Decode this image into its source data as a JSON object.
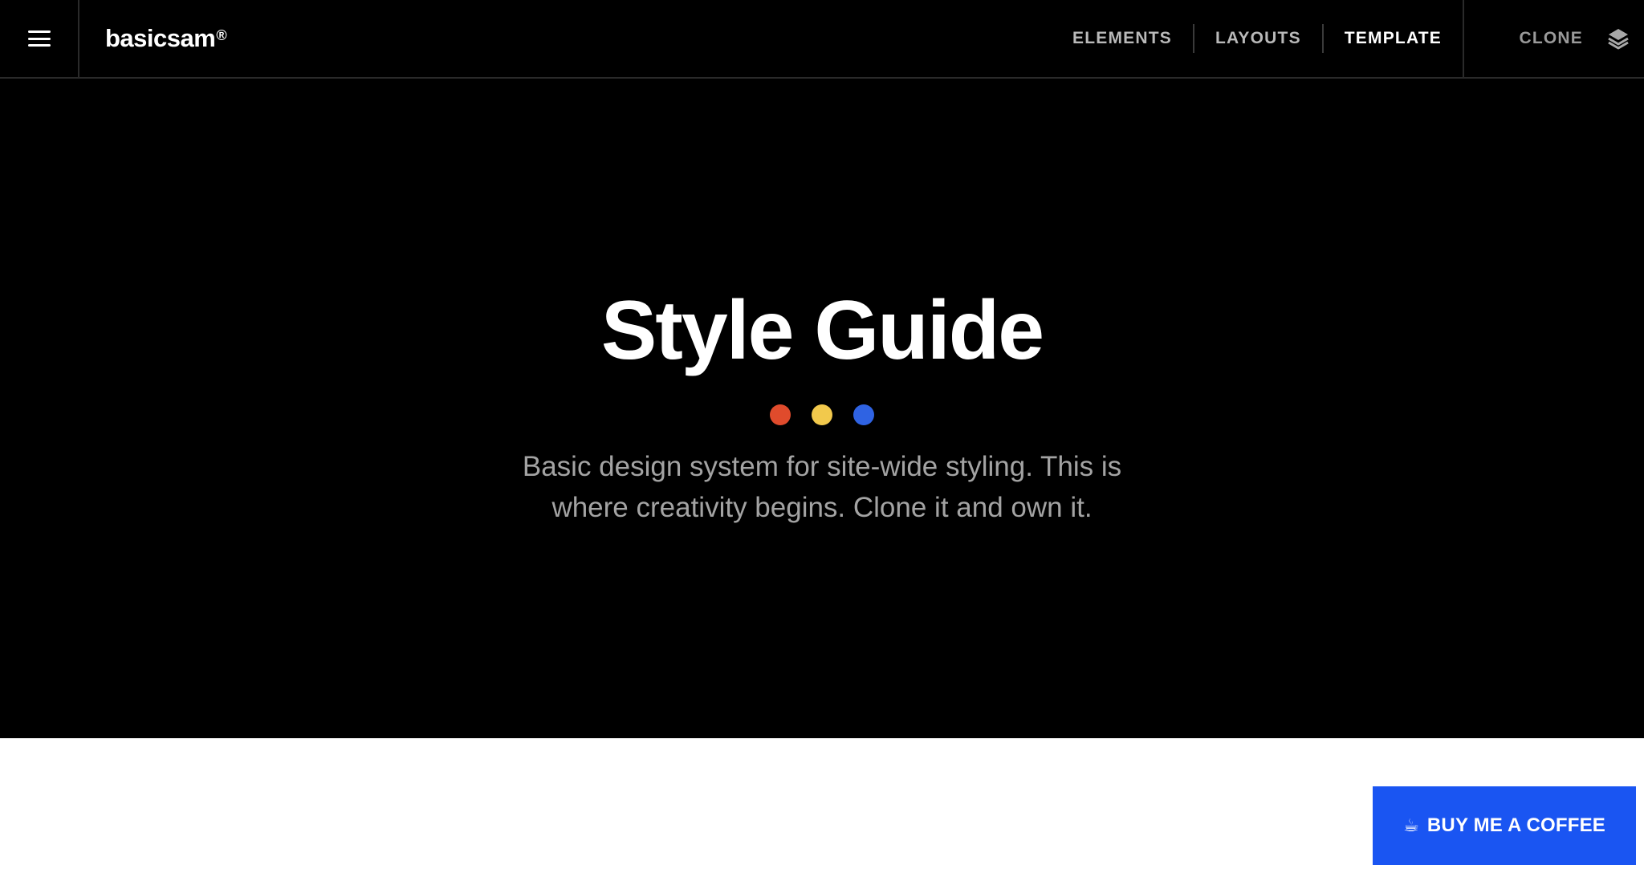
{
  "header": {
    "logo_text": "basicsam",
    "logo_mark": "®",
    "nav": [
      {
        "label": "ELEMENTS"
      },
      {
        "label": "LAYOUTS"
      },
      {
        "label": "TEMPLATE"
      }
    ],
    "clone_label": "CLONE",
    "menu_icon": "hamburger-icon",
    "layers_icon": "layers-icon"
  },
  "hero": {
    "title": "Style Guide",
    "subtitle": "Basic design system for site-wide styling. This is where creativity begins. Clone it and own it.",
    "dots": [
      "#e04b2c",
      "#f2c94c",
      "#2f63e3"
    ]
  },
  "cta": {
    "icon": "☕",
    "label": "BUY ME A COFFEE",
    "color": "#1a55f2"
  }
}
